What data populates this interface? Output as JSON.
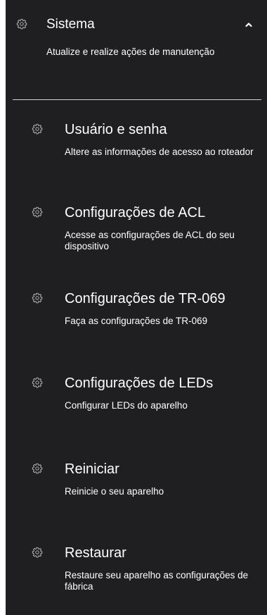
{
  "system": {
    "title": "Sistema",
    "description": "Atualize e realize ações de manutenção",
    "icon": "gear-icon",
    "toggle_icon": "chevron-up-icon"
  },
  "items": [
    {
      "title": "Usuário e senha",
      "description": "Altere as informações de acesso ao roteador",
      "icon": "gear-icon"
    },
    {
      "title": "Configurações de ACL",
      "description": "Acesse as configurações de ACL do seu dispositivo",
      "icon": "gear-icon"
    },
    {
      "title": "Configurações de TR-069",
      "description": "Faça as configurações de TR-069",
      "icon": "gear-icon"
    },
    {
      "title": "Configurações de LEDs",
      "description": "Configurar LEDs do aparelho",
      "icon": "gear-icon"
    },
    {
      "title": "Reiniciar",
      "description": "Reinicie o seu aparelho",
      "icon": "gear-icon"
    },
    {
      "title": "Restaurar",
      "description": "Restaure seu aparelho as configurações de fábrica",
      "icon": "gear-icon"
    }
  ],
  "colors": {
    "background": "#1f1f21",
    "text": "#ffffff",
    "divider": "#d4d4d4"
  }
}
